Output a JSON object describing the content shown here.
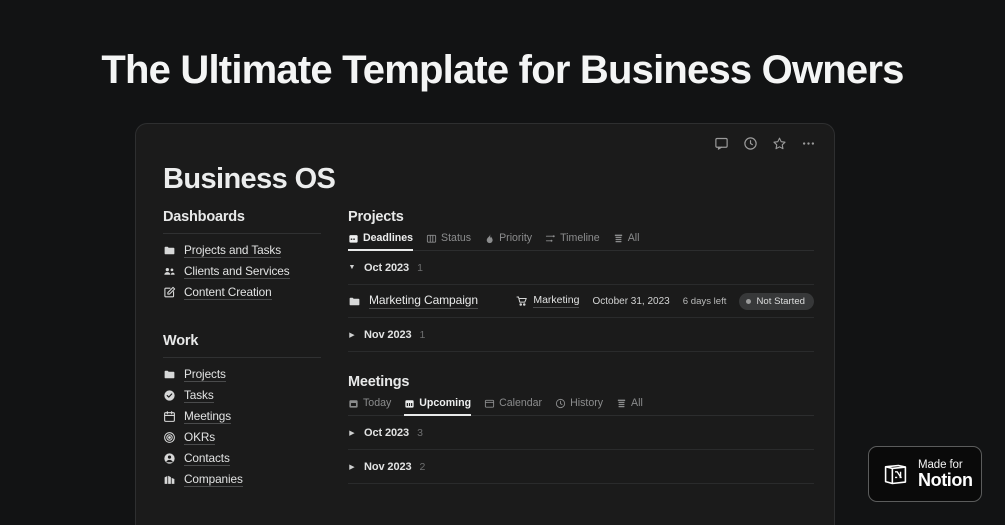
{
  "headline": "The Ultimate Template for Business Owners",
  "window": {
    "page_title": "Business OS",
    "toolbar_icons": [
      "comment-icon",
      "history-clock-icon",
      "star-icon",
      "more-options-icon"
    ]
  },
  "sidebar": {
    "groups": [
      {
        "heading": "Dashboards",
        "items": [
          {
            "label": "Projects and Tasks",
            "icon": "folder-icon"
          },
          {
            "label": "Clients and Services",
            "icon": "people-icon"
          },
          {
            "label": "Content Creation",
            "icon": "pencil-square-icon"
          }
        ]
      },
      {
        "heading": "Work",
        "items": [
          {
            "label": "Projects",
            "icon": "folder-icon"
          },
          {
            "label": "Tasks",
            "icon": "check-circle-icon"
          },
          {
            "label": "Meetings",
            "icon": "calendar-icon"
          },
          {
            "label": "OKRs",
            "icon": "target-icon"
          },
          {
            "label": "Contacts",
            "icon": "person-circle-icon"
          },
          {
            "label": "Companies",
            "icon": "building-icon"
          }
        ]
      }
    ]
  },
  "main": {
    "projects": {
      "title": "Projects",
      "tabs": [
        {
          "label": "Deadlines",
          "icon": "calendar-icon",
          "active": true
        },
        {
          "label": "Status",
          "icon": "board-icon",
          "active": false
        },
        {
          "label": "Priority",
          "icon": "flame-icon",
          "active": false
        },
        {
          "label": "Timeline",
          "icon": "timeline-icon",
          "active": false
        },
        {
          "label": "All",
          "icon": "list-icon",
          "active": false
        }
      ],
      "groups": [
        {
          "label": "Oct 2023",
          "count": "1",
          "expanded": true,
          "rows": [
            {
              "icon": "folder-icon",
              "name": "Marketing Campaign",
              "tag": "Marketing",
              "tag_icon": "cart-icon",
              "date": "October 31, 2023",
              "remaining": "6 days left",
              "status": "Not Started",
              "status_color": "#373839"
            }
          ]
        },
        {
          "label": "Nov 2023",
          "count": "1",
          "expanded": false,
          "rows": []
        }
      ]
    },
    "meetings": {
      "title": "Meetings",
      "tabs": [
        {
          "label": "Today",
          "icon": "calendar-today-icon",
          "active": false
        },
        {
          "label": "Upcoming",
          "icon": "calendar-month-icon",
          "active": true
        },
        {
          "label": "Calendar",
          "icon": "calendar-outline-icon",
          "active": false
        },
        {
          "label": "History",
          "icon": "clock-icon",
          "active": false
        },
        {
          "label": "All",
          "icon": "list-icon",
          "active": false
        }
      ],
      "groups": [
        {
          "label": "Oct 2023",
          "count": "3",
          "expanded": false,
          "rows": []
        },
        {
          "label": "Nov 2023",
          "count": "2",
          "expanded": false,
          "rows": []
        }
      ]
    }
  },
  "made_for_notion": {
    "line1": "Made for",
    "line2": "Notion",
    "logo": "notion-logo-icon"
  },
  "colors": {
    "page_background": "#121314",
    "panel_background": "#1b1b1b",
    "text_primary": "#e9eaea",
    "text_muted": "#8b8c8d",
    "divider": "#2a2b2c",
    "badge_background": "#373839"
  }
}
